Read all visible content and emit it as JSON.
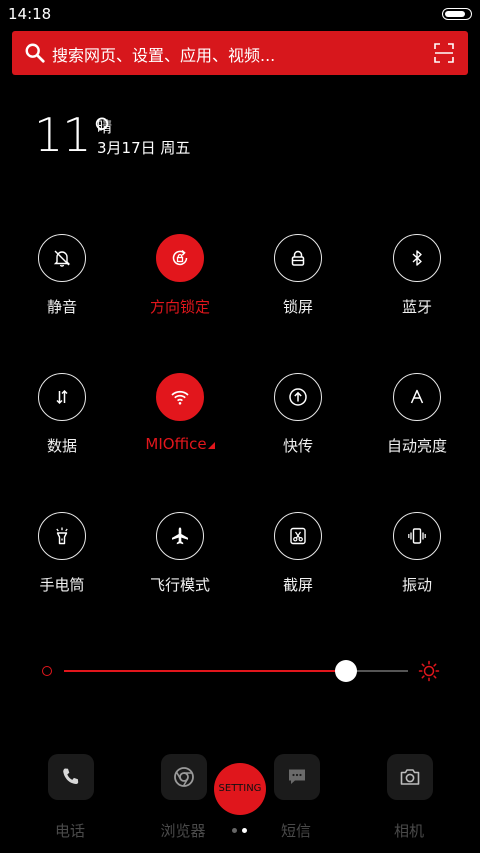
{
  "status_bar": {
    "time": "14:18",
    "battery_level": 0.85
  },
  "search": {
    "placeholder": "搜索网页、设置、应用、视频..."
  },
  "weather": {
    "temperature": "11°",
    "condition": "晴",
    "date": "3月17日  周五"
  },
  "toggles": [
    {
      "label": "静音",
      "icon": "silent-bell-icon",
      "active": false
    },
    {
      "label": "方向锁定",
      "icon": "rotation-lock-icon",
      "active": true
    },
    {
      "label": "锁屏",
      "icon": "lock-icon",
      "active": false
    },
    {
      "label": "蓝牙",
      "icon": "bluetooth-icon",
      "active": false
    },
    {
      "label": "数据",
      "icon": "mobile-data-icon",
      "active": false
    },
    {
      "label": "MIOffice",
      "icon": "wifi-icon",
      "active": true
    },
    {
      "label": "快传",
      "icon": "share-transfer-icon",
      "active": false
    },
    {
      "label": "自动亮度",
      "icon": "auto-brightness-icon",
      "active": false
    },
    {
      "label": "手电筒",
      "icon": "flashlight-icon",
      "active": false
    },
    {
      "label": "飞行模式",
      "icon": "airplane-icon",
      "active": false
    },
    {
      "label": "截屏",
      "icon": "screenshot-icon",
      "active": false
    },
    {
      "label": "振动",
      "icon": "vibrate-icon",
      "active": false
    }
  ],
  "brightness": {
    "level": 0.82,
    "low_icon": "brightness-low-icon",
    "high_icon": "brightness-high-icon"
  },
  "dock": [
    {
      "label": "电话",
      "icon": "phone-icon"
    },
    {
      "label": "浏览器",
      "icon": "browser-icon"
    },
    {
      "label": "短信",
      "icon": "message-icon"
    },
    {
      "label": "相机",
      "icon": "camera-icon"
    }
  ],
  "setting_button": {
    "label": "SETTING"
  },
  "pagination": {
    "pages": 2,
    "current": 2
  },
  "colors": {
    "accent": "#e2161c",
    "background": "#000000",
    "dock_tile": "#1b1b1b",
    "dock_label": "#4a4a4a"
  }
}
